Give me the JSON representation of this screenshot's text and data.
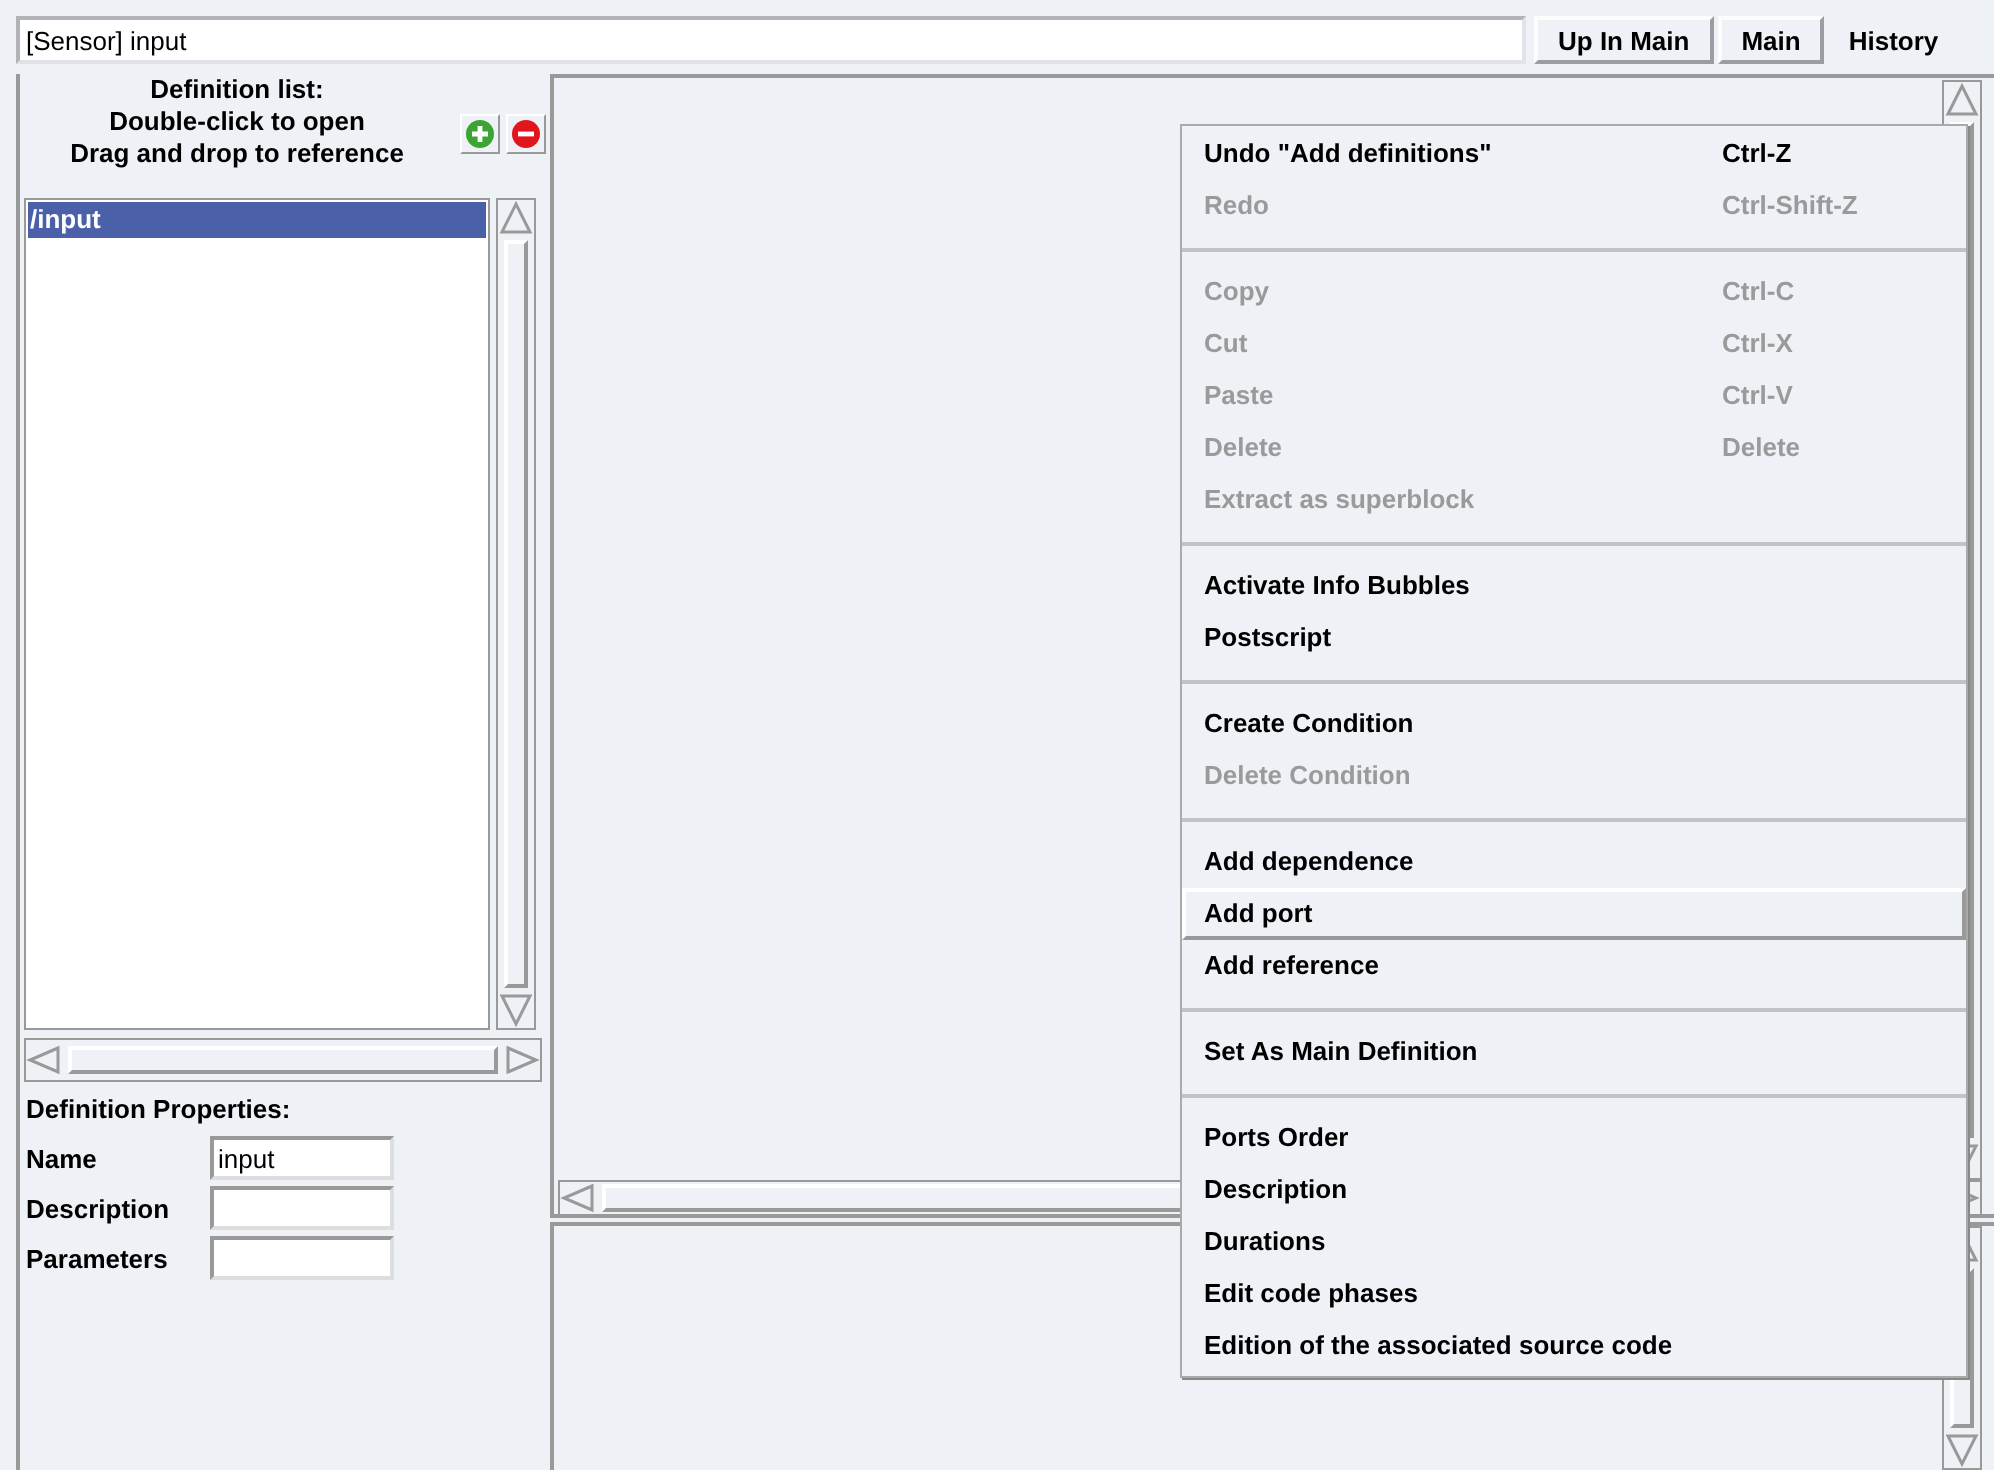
{
  "title_field": {
    "value": "[Sensor] input"
  },
  "nav_buttons": [
    {
      "label": "Up In Main",
      "kind": "button"
    },
    {
      "label": "Main",
      "kind": "button"
    },
    {
      "label": "History",
      "kind": "flat"
    }
  ],
  "definition_panel": {
    "heading": [
      "Definition list:",
      "Double-click to open",
      "Drag and drop to reference"
    ],
    "items": [
      {
        "label": "/input",
        "selected": true
      }
    ]
  },
  "properties": {
    "heading": "Definition Properties:",
    "fields": [
      {
        "label": "Name",
        "value": "input"
      },
      {
        "label": "Description"
      },
      {
        "label": "Parameters"
      }
    ]
  },
  "context_menu": [
    {
      "kind": "item",
      "label": "Undo \"Add definitions\"",
      "shortcut": "Ctrl-Z",
      "disabled": false,
      "selected": false
    },
    {
      "kind": "item",
      "label": "Redo",
      "shortcut": "Ctrl-Shift-Z",
      "disabled": true,
      "selected": false
    },
    {
      "kind": "separator"
    },
    {
      "kind": "item",
      "label": "Copy",
      "shortcut": "Ctrl-C",
      "disabled": true,
      "selected": false
    },
    {
      "kind": "item",
      "label": "Cut",
      "shortcut": "Ctrl-X",
      "disabled": true,
      "selected": false
    },
    {
      "kind": "item",
      "label": "Paste",
      "shortcut": "Ctrl-V",
      "disabled": true,
      "selected": false
    },
    {
      "kind": "item",
      "label": "Delete",
      "shortcut": "Delete",
      "disabled": true,
      "selected": false
    },
    {
      "kind": "item",
      "label": "Extract as superblock",
      "disabled": true,
      "selected": false
    },
    {
      "kind": "separator"
    },
    {
      "kind": "item",
      "label": "Activate Info Bubbles",
      "disabled": false,
      "selected": false
    },
    {
      "kind": "item",
      "label": "Postscript",
      "disabled": false,
      "selected": false
    },
    {
      "kind": "separator"
    },
    {
      "kind": "item",
      "label": "Create Condition",
      "disabled": false,
      "selected": false
    },
    {
      "kind": "item",
      "label": "Delete Condition",
      "disabled": true,
      "selected": false
    },
    {
      "kind": "separator"
    },
    {
      "kind": "item",
      "label": "Add dependence",
      "disabled": false,
      "selected": false
    },
    {
      "kind": "item",
      "label": "Add port",
      "disabled": false,
      "selected": true
    },
    {
      "kind": "item",
      "label": "Add reference",
      "disabled": false,
      "selected": false
    },
    {
      "kind": "separator"
    },
    {
      "kind": "item",
      "label": "Set As Main Definition",
      "disabled": false,
      "selected": false
    },
    {
      "kind": "separator"
    },
    {
      "kind": "item",
      "label": "Ports Order",
      "disabled": false,
      "selected": false
    },
    {
      "kind": "item",
      "label": "Description",
      "disabled": false,
      "selected": false
    },
    {
      "kind": "item",
      "label": "Durations",
      "disabled": false,
      "selected": false
    },
    {
      "kind": "item",
      "label": "Edit code phases",
      "disabled": false,
      "selected": false
    },
    {
      "kind": "item",
      "label": "Edition of the associated source code",
      "disabled": false,
      "selected": false
    }
  ]
}
